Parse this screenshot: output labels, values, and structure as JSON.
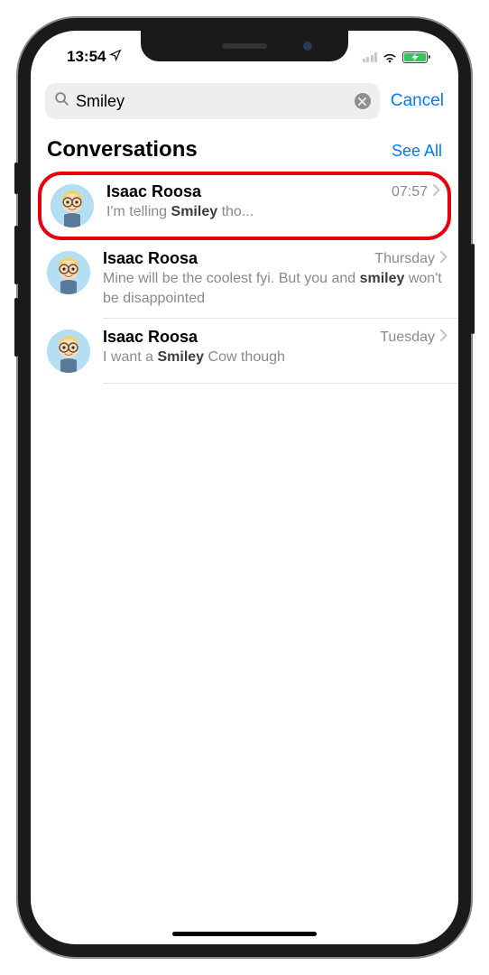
{
  "status": {
    "time": "13:54",
    "location_services": true,
    "battery_charging": true
  },
  "search": {
    "query": "Smiley",
    "cancel_label": "Cancel"
  },
  "section": {
    "title": "Conversations",
    "see_all_label": "See All"
  },
  "results": [
    {
      "name": "Isaac Roosa",
      "timestamp": "07:57",
      "preview_before": "I'm telling ",
      "preview_match": "Smiley",
      "preview_after": " tho...",
      "highlighted": true
    },
    {
      "name": "Isaac Roosa",
      "timestamp": "Thursday",
      "preview_before": "Mine will be the coolest fyi. But you and ",
      "preview_match": "smiley",
      "preview_after": " won't be disappointed",
      "highlighted": false
    },
    {
      "name": "Isaac Roosa",
      "timestamp": "Tuesday",
      "preview_before": "I want a ",
      "preview_match": "Smiley",
      "preview_after": " Cow though",
      "highlighted": false
    }
  ]
}
